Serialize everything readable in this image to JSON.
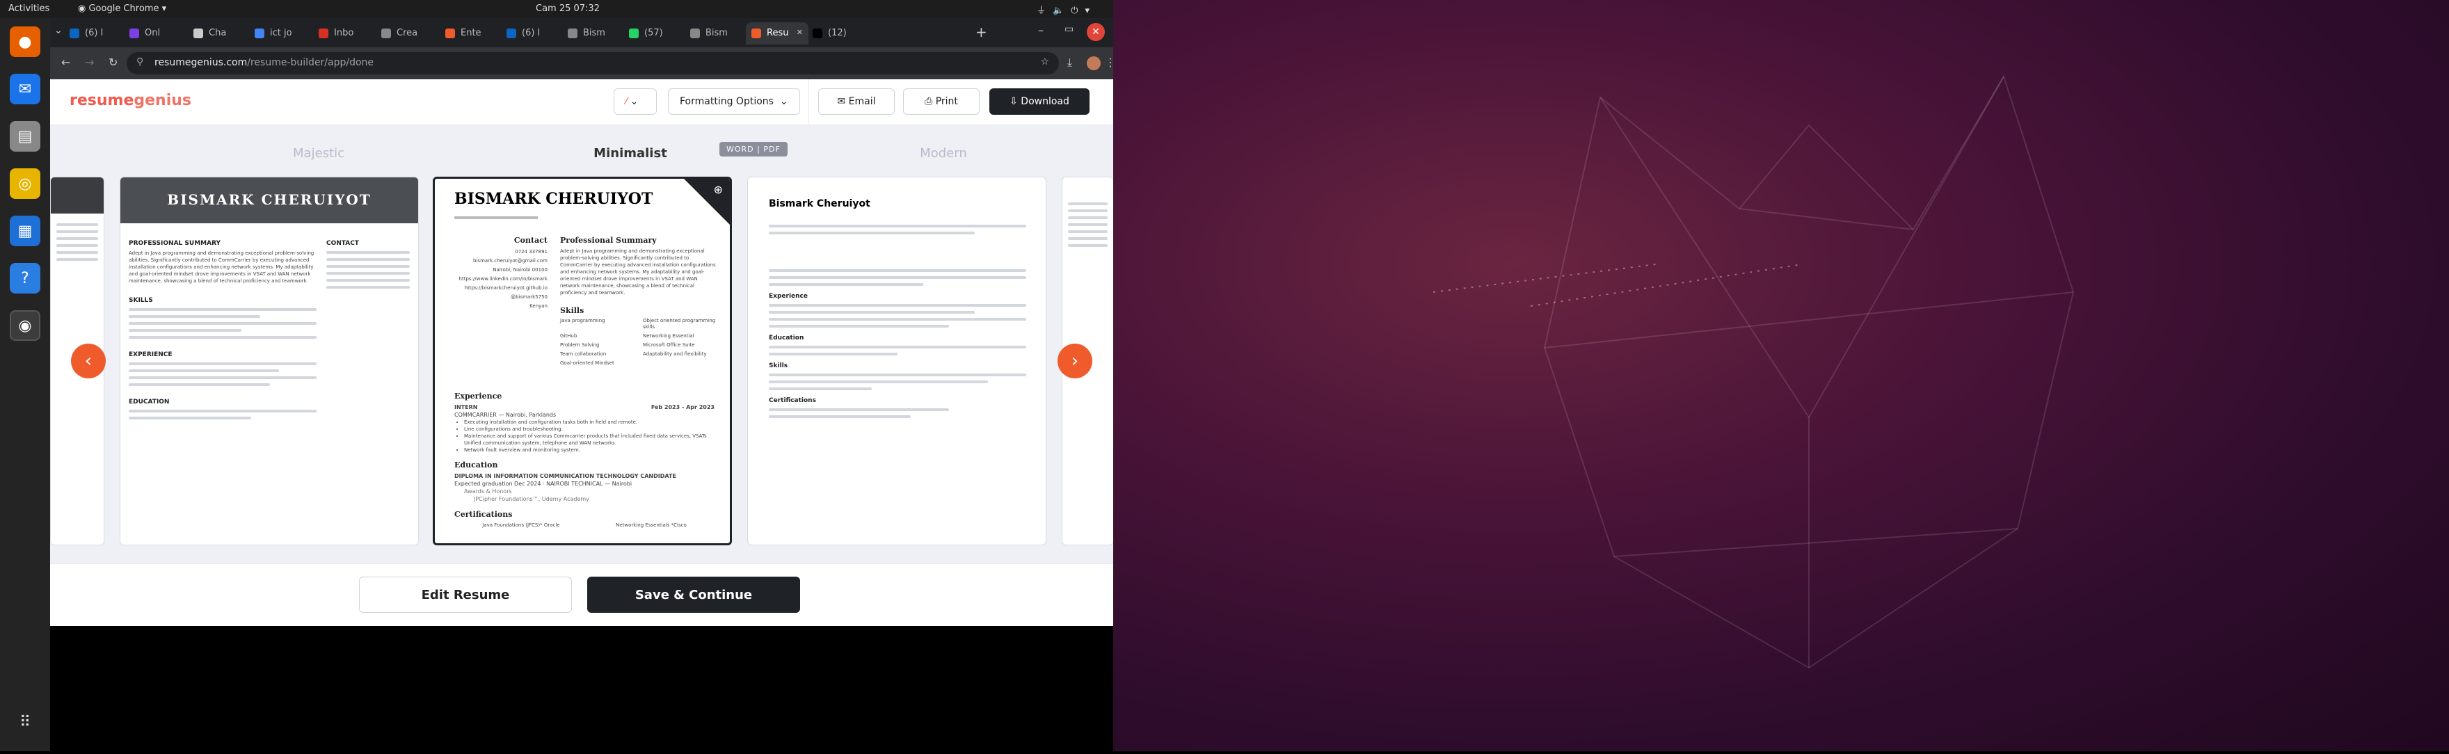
{
  "system": {
    "activities": "Activities",
    "app_name": "Google Chrome",
    "clock": "Cam 25  07:32"
  },
  "browser": {
    "tabs": [
      {
        "label": "(6) I",
        "color": "#0a66c2"
      },
      {
        "label": "Onl",
        "color": "#7b3fe4"
      },
      {
        "label": "Cha",
        "color": "#cccccc"
      },
      {
        "label": "ict jo",
        "color": "#4285f4"
      },
      {
        "label": "Inbo",
        "color": "#d93025"
      },
      {
        "label": "Crea",
        "color": "#888888"
      },
      {
        "label": "Ente",
        "color": "#ef5b2b"
      },
      {
        "label": "(6) I",
        "color": "#0a66c2"
      },
      {
        "label": "Bism",
        "color": "#888888"
      },
      {
        "label": "(57)",
        "color": "#25d366"
      },
      {
        "label": "Bism",
        "color": "#888888"
      },
      {
        "label": "Resu",
        "color": "#ef5b2b"
      },
      {
        "label": "(12)",
        "color": "#000000"
      }
    ],
    "active_tab": 11,
    "url_domain": "resumegenius.com",
    "url_path": "/resume-builder/app/done"
  },
  "app": {
    "logo_resume": "resume",
    "logo_genius": "genius",
    "formatting_label": "Formatting Options",
    "email_label": "Email",
    "print_label": "Print",
    "download_label": "Download",
    "accent": "#ef5b2b"
  },
  "templates": {
    "left_name": "Majestic",
    "center_name": "Minimalist",
    "right_name": "Modern",
    "format_badge": "WORD | PDF"
  },
  "resume": {
    "name_caps": "BISMARK CHERUIYOT",
    "name_title": "Bismark Cheruiyot",
    "sections": {
      "contact": "Contact",
      "summary": "Professional Summary",
      "skills": "Skills",
      "experience": "Experience",
      "education": "Education",
      "certifications": "Certifications",
      "summary_caps": "PROFESSIONAL SUMMARY",
      "skills_caps": "SKILLS",
      "experience_caps": "EXPERIENCE",
      "education_caps": "EDUCATION",
      "contact_caps": "CONTACT"
    },
    "contact": [
      "0724 337891",
      "bismark.cheruiyot@gmail.com",
      "Nairobi, Nairobi 00100",
      "https://www.linkedin.com/in/bismark",
      "https://bismarkcheruiyot.github.io",
      "@bismark5750",
      "Kenyan"
    ],
    "summary": "Adept in Java programming and demonstrating exceptional problem-solving abilities. Significantly contributed to CommCarrier by executing advanced installation configurations and enhancing network systems. My adaptability and goal-oriented mindset drove improvements in VSAT and WAN network maintenance, showcasing a blend of technical proficiency and teamwork.",
    "skills": [
      "Java programming",
      "Object oriented programming skills",
      "GitHub",
      "Networking Essential",
      "Problem Solving",
      "Microsoft Office Suite",
      "Team collaboration",
      "Adaptability and flexibility",
      "Goal-oriented Mindset"
    ],
    "job": {
      "title": "INTERN",
      "dates": "Feb 2023 - Apr 2023",
      "company": "COMMCARRIER — Nairobi, Parklands",
      "bullets": [
        "Executing installation and configuration tasks both in field and remote.",
        "Line configurations and troubleshooting.",
        "Maintenance and support of various Commcarrier products that included fixed data services, VSATs Unified communication system, telephone and WAN networks.",
        "Network fault overview and monitoring system."
      ]
    },
    "education": {
      "degree": "DIPLOMA IN INFORMATION COMMUNICATION TECHNOLOGY CANDIDATE",
      "expected": "Expected graduation Dec 2024 · NAIROBI TECHNICAL — Nairobi",
      "award_label": "Awards & Honors",
      "award": "JPCipher Foundations™, Udemy Academy"
    },
    "certifications": [
      "Java Foundations (JFCS)* Oracle",
      "Networking Essentials *Cisco"
    ]
  },
  "footer": {
    "edit_label": "Edit Resume",
    "save_label": "Save & Continue"
  }
}
